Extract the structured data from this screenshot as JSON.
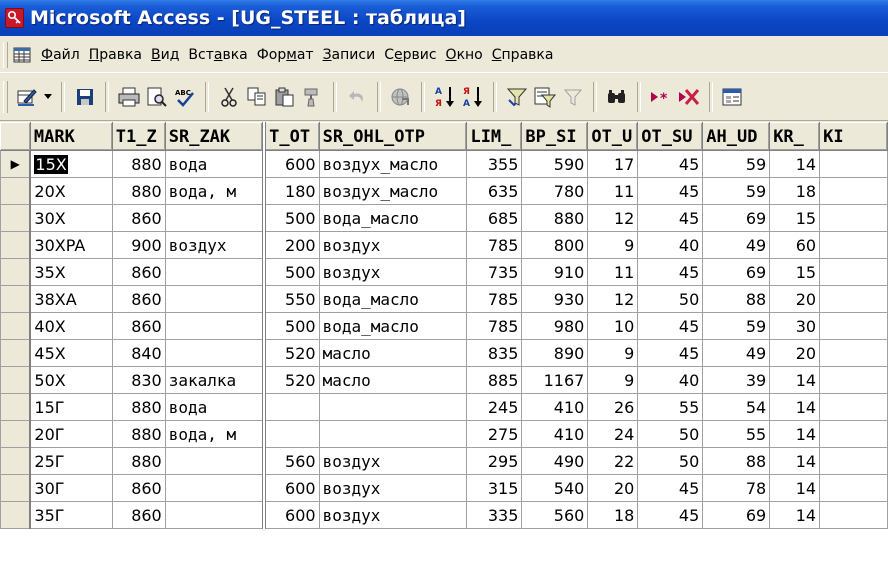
{
  "window": {
    "title": "Microsoft Access - [UG_STEEL : таблица]"
  },
  "menu": {
    "items": [
      {
        "pre": "",
        "u": "Ф",
        "post": "айл"
      },
      {
        "pre": "",
        "u": "П",
        "post": "равка"
      },
      {
        "pre": "",
        "u": "В",
        "post": "ид"
      },
      {
        "pre": "Вст",
        "u": "а",
        "post": "вка"
      },
      {
        "pre": "Фор",
        "u": "м",
        "post": "ат"
      },
      {
        "pre": "",
        "u": "З",
        "post": "аписи"
      },
      {
        "pre": "С",
        "u": "е",
        "post": "рвис"
      },
      {
        "pre": "",
        "u": "О",
        "post": "кно"
      },
      {
        "pre": "",
        "u": "С",
        "post": "правка"
      }
    ]
  },
  "toolbar": {
    "icons": [
      "view-design-icon",
      "dropdown-arrow-icon",
      "save-icon",
      "print-icon",
      "print-preview-icon",
      "spelling-icon",
      "cut-icon",
      "copy-icon",
      "paste-icon",
      "format-painter-icon",
      "undo-icon",
      "hyperlink-icon",
      "sort-ascending-icon",
      "sort-descending-icon",
      "filter-by-selection-icon",
      "filter-by-form-icon",
      "apply-filter-icon",
      "find-icon",
      "new-record-icon",
      "delete-record-icon",
      "database-window-icon"
    ]
  },
  "table": {
    "columns": [
      "MARK",
      "T1_Z",
      "SR_ZAK",
      "T_OT",
      "SR_OHL_OTP",
      "LIM_",
      "BP_SI",
      "OT_U",
      "OT_SU",
      "AH_UD",
      "KR_",
      "KI"
    ],
    "current_row_marker": "▶",
    "rows": [
      [
        "15X",
        "880",
        "вода",
        "600",
        "воздух_масло",
        "355",
        "590",
        "17",
        "45",
        "59",
        "14",
        ""
      ],
      [
        "20X",
        "880",
        "вода, м",
        "180",
        "воздух_масло",
        "635",
        "780",
        "11",
        "45",
        "59",
        "18",
        ""
      ],
      [
        "30X",
        "860",
        "",
        "500",
        "вода_масло",
        "685",
        "880",
        "12",
        "45",
        "69",
        "15",
        ""
      ],
      [
        "30XPA",
        "900",
        "воздух",
        "200",
        "воздух",
        "785",
        "800",
        "9",
        "40",
        "49",
        "60",
        ""
      ],
      [
        "35X",
        "860",
        "",
        "500",
        "воздух",
        "735",
        "910",
        "11",
        "45",
        "69",
        "15",
        ""
      ],
      [
        "38XA",
        "860",
        "",
        "550",
        "вода_масло",
        "785",
        "930",
        "12",
        "50",
        "88",
        "20",
        ""
      ],
      [
        "40X",
        "860",
        "",
        "500",
        "вода_масло",
        "785",
        "980",
        "10",
        "45",
        "59",
        "30",
        ""
      ],
      [
        "45X",
        "840",
        "",
        "520",
        "масло",
        "835",
        "890",
        "9",
        "45",
        "49",
        "20",
        ""
      ],
      [
        "50X",
        "830",
        "закалка",
        "520",
        "масло",
        "885",
        "1167",
        "9",
        "40",
        "39",
        "14",
        ""
      ],
      [
        "15Г",
        "880",
        "вода",
        "",
        "",
        "245",
        "410",
        "26",
        "55",
        "54",
        "14",
        ""
      ],
      [
        "20Г",
        "880",
        "вода, м",
        "",
        "",
        "275",
        "410",
        "24",
        "50",
        "55",
        "14",
        ""
      ],
      [
        "25Г",
        "880",
        "",
        "560",
        "воздух",
        "295",
        "490",
        "22",
        "50",
        "88",
        "14",
        ""
      ],
      [
        "30Г",
        "860",
        "",
        "600",
        "воздух",
        "315",
        "540",
        "20",
        "45",
        "78",
        "14",
        ""
      ],
      [
        "35Г",
        "860",
        "",
        "600",
        "воздух",
        "335",
        "560",
        "18",
        "45",
        "69",
        "14",
        ""
      ]
    ]
  }
}
